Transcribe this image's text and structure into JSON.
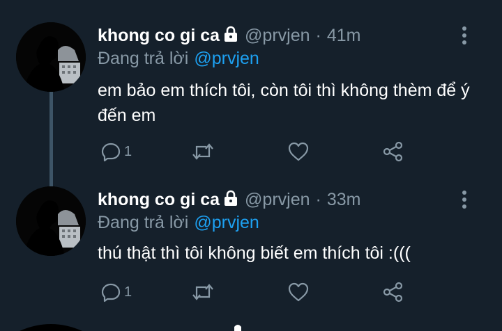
{
  "tweets": [
    {
      "display_name": "khong co gi ca",
      "handle": "@prvjen",
      "separator": "·",
      "time": "41m",
      "reply_label": "Đang trả lời",
      "reply_to": "@prvjen",
      "text": "em bảo em thích tôi, còn tôi thì không thèm để ý đến em",
      "reply_count": "1"
    },
    {
      "display_name": "khong co gi ca",
      "handle": "@prvjen",
      "separator": "·",
      "time": "33m",
      "reply_label": "Đang trả lời",
      "reply_to": "@prvjen",
      "text": "thú thật thì tôi không biết em thích tôi :(((",
      "reply_count": "1"
    }
  ],
  "icons": {
    "protected": "lock-icon",
    "more": "more-vertical-icon",
    "reply": "reply-icon",
    "retweet": "retweet-icon",
    "like": "heart-icon",
    "share": "share-icon"
  },
  "colors": {
    "background": "#15202b",
    "primary_text": "#ffffff",
    "secondary_text": "#8899a6",
    "link": "#1da1f2",
    "thread_line": "#3d5466"
  }
}
